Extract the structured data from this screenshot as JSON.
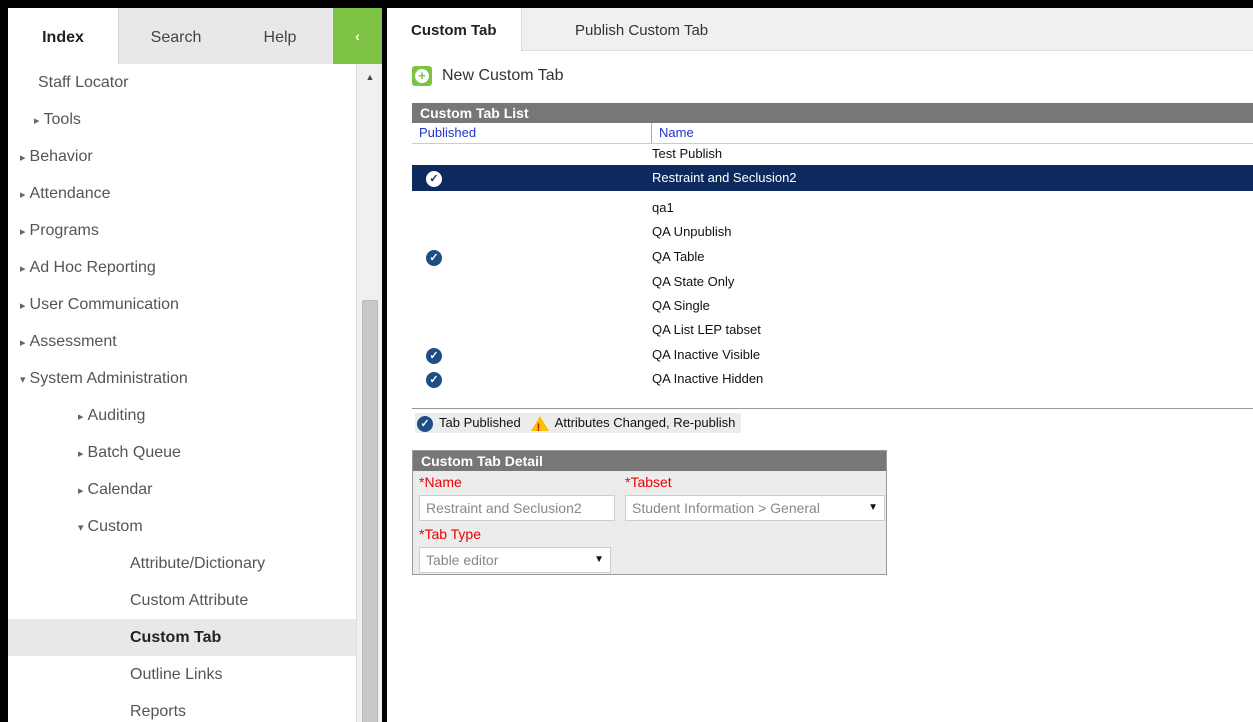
{
  "left_tabs": {
    "index": "Index",
    "search": "Search",
    "help": "Help",
    "collapse": "‹"
  },
  "nav": [
    {
      "label": "Staff Locator",
      "indent": 2,
      "arrow": ""
    },
    {
      "label": "Tools",
      "indent": 2,
      "arrow": "▸"
    },
    {
      "label": "Behavior",
      "indent": 0,
      "arrow": "▸"
    },
    {
      "label": "Attendance",
      "indent": 0,
      "arrow": "▸"
    },
    {
      "label": "Programs",
      "indent": 0,
      "arrow": "▸"
    },
    {
      "label": "Ad Hoc Reporting",
      "indent": 0,
      "arrow": "▸"
    },
    {
      "label": "User Communication",
      "indent": 0,
      "arrow": "▸"
    },
    {
      "label": "Assessment",
      "indent": 0,
      "arrow": "▸"
    },
    {
      "label": "System Administration",
      "indent": 0,
      "arrow": "▾"
    },
    {
      "label": "Auditing",
      "indent": 1,
      "arrow": "▸"
    },
    {
      "label": "Batch Queue",
      "indent": 1,
      "arrow": "▸"
    },
    {
      "label": "Calendar",
      "indent": 1,
      "arrow": "▸"
    },
    {
      "label": "Custom",
      "indent": 1,
      "arrow": "▾"
    },
    {
      "label": "Attribute/Dictionary",
      "indent": 3,
      "arrow": ""
    },
    {
      "label": "Custom Attribute",
      "indent": 3,
      "arrow": ""
    },
    {
      "label": "Custom Tab",
      "indent": 3,
      "arrow": "",
      "active": true
    },
    {
      "label": "Outline Links",
      "indent": 3,
      "arrow": ""
    },
    {
      "label": "Reports",
      "indent": 3,
      "arrow": ""
    }
  ],
  "right_tabs": {
    "custom_tab": "Custom Tab",
    "publish_custom_tab": "Publish Custom Tab"
  },
  "new_custom_tab": "New Custom Tab",
  "list": {
    "title": "Custom Tab List",
    "col_published": "Published",
    "col_name": "Name",
    "rows": [
      {
        "name": "Test Publish",
        "published": false
      },
      {
        "name": "Restraint and Seclusion2",
        "published": true,
        "selected": true
      },
      {
        "name": "qa1",
        "published": false
      },
      {
        "name": "QA Unpublish",
        "published": false
      },
      {
        "name": "QA Table",
        "published": true
      },
      {
        "name": "QA State Only",
        "published": false
      },
      {
        "name": "QA Single",
        "published": false
      },
      {
        "name": "QA List LEP tabset",
        "published": false
      },
      {
        "name": "QA Inactive Visible",
        "published": true
      },
      {
        "name": "QA Inactive Hidden",
        "published": true
      }
    ]
  },
  "legend": {
    "published": "Tab Published",
    "changed": "Attributes Changed, Re-publish"
  },
  "detail": {
    "title": "Custom Tab Detail",
    "name_label": "*Name",
    "name_value": "Restraint and Seclusion2",
    "tabset_label": "*Tabset",
    "tabset_value": "Student Information > General",
    "type_label": "*Tab Type",
    "type_value": "Table editor"
  },
  "colors": {
    "accent_green": "#7dc242",
    "selected_row": "#0d2a5e",
    "required": "#e00000"
  }
}
